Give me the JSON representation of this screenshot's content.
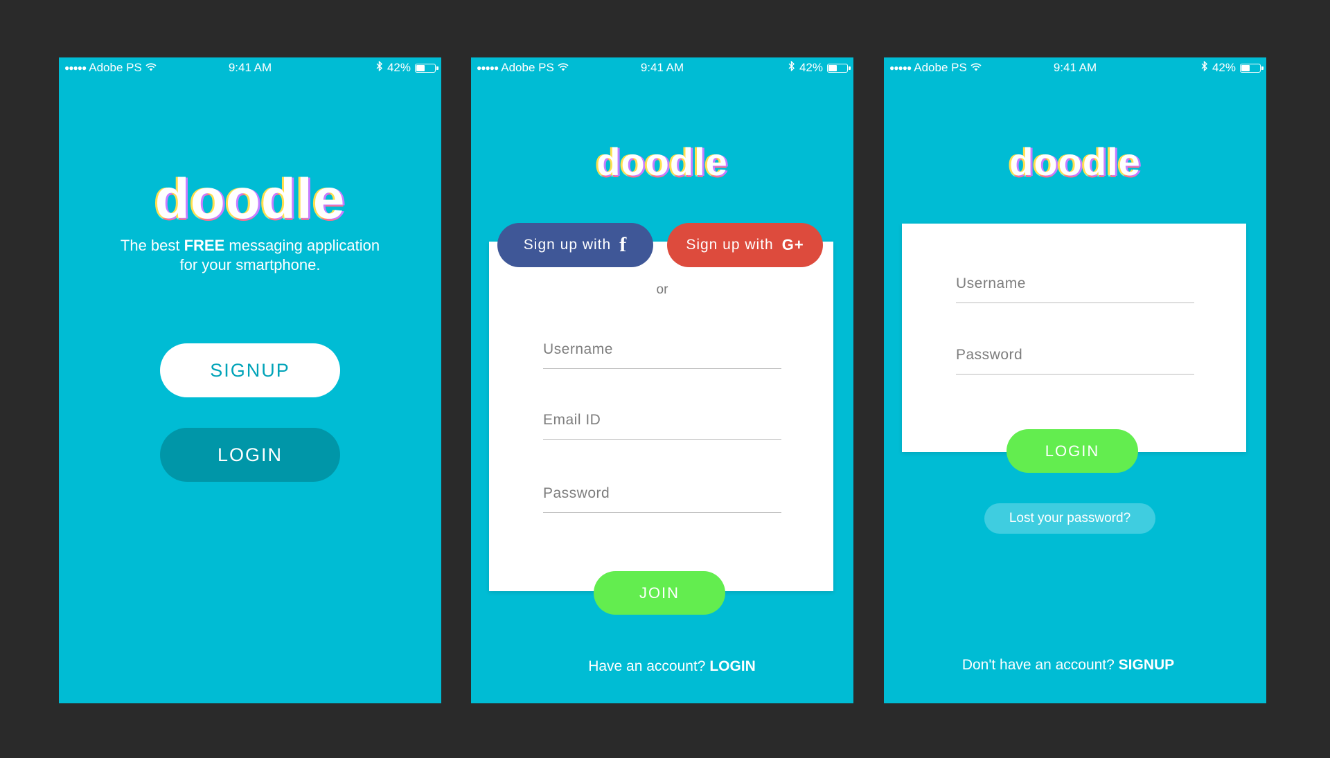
{
  "status_bar": {
    "carrier": "Adobe PS",
    "time": "9:41 AM",
    "battery": "42%",
    "signal_dots": "●●●●●"
  },
  "logo_text": "doodle",
  "welcome": {
    "tagline_pre": "The best ",
    "tagline_bold": "FREE",
    "tagline_post": " messaging application",
    "tagline_line2": "for your smartphone.",
    "signup_label": "SIGNUP",
    "login_label": "LOGIN"
  },
  "signup": {
    "facebook_label": "Sign up with",
    "facebook_glyph": "f",
    "google_label": "Sign up with",
    "google_glyph": "G+",
    "or_text": "or",
    "username_placeholder": "Username",
    "email_placeholder": "Email ID",
    "password_placeholder": "Password",
    "join_label": "JOIN",
    "footer_text": "Have an account? ",
    "footer_link": "LOGIN"
  },
  "login": {
    "username_placeholder": "Username",
    "password_placeholder": "Password",
    "login_label": "LOGIN",
    "lost_password_label": "Lost your password?",
    "footer_text": "Don't have an account? ",
    "footer_link": "SIGNUP"
  },
  "colors": {
    "background": "#2a2a2a",
    "screen": "#00bcd4",
    "login_dark": "#0096a8",
    "facebook": "#3f5797",
    "google": "#dd4b3d",
    "green": "#63ed4f",
    "lost_password": "#3fcde0"
  }
}
